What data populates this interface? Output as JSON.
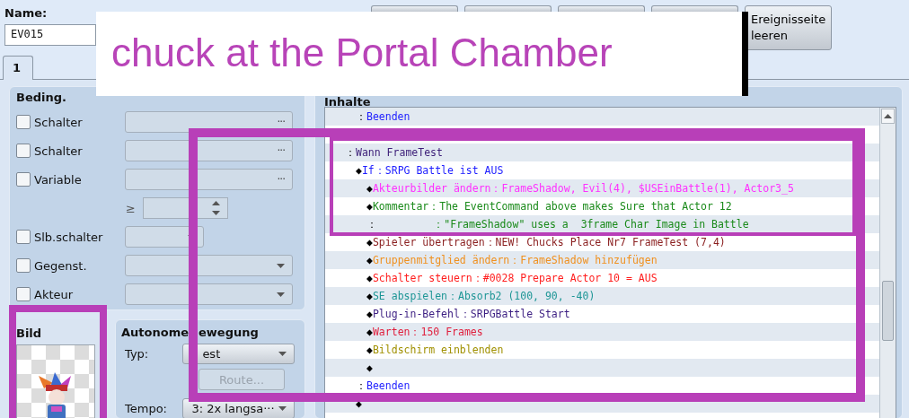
{
  "name_field": {
    "label": "Name:",
    "value": "EV015"
  },
  "page_buttons": [
    {
      "kind": "covered"
    },
    {
      "kind": "covered"
    },
    {
      "kind": "covered"
    },
    {
      "kind": "covered"
    },
    {
      "kind": "label",
      "label": "Ereignisseite leeren"
    }
  ],
  "tabs": [
    {
      "label": "1",
      "selected": true
    }
  ],
  "conditions": {
    "title": "Beding.",
    "rows": [
      {
        "kind": "picker",
        "label": "Schalter",
        "checked": false,
        "button": "···"
      },
      {
        "kind": "picker",
        "label": "Schalter",
        "checked": false,
        "button": "···"
      },
      {
        "kind": "picker",
        "label": "Variable",
        "checked": false,
        "button": "···"
      },
      {
        "kind": "spinner",
        "label": "≥"
      },
      {
        "kind": "small_dropdown",
        "label": "Slb.schalter",
        "checked": false
      },
      {
        "kind": "dropdown",
        "label": "Gegenst.",
        "checked": false
      },
      {
        "kind": "dropdown",
        "label": "Akteur",
        "checked": false
      }
    ]
  },
  "image": {
    "title": "Bild",
    "kind": "picture"
  },
  "autonomous_movement": {
    "title": "Autonome",
    "title_continued": "ewegung",
    "type": {
      "label": "Typ:",
      "value": "est"
    },
    "route_button": {
      "label": "Route...",
      "disabled": true
    },
    "speed": {
      "label": "Tempo:",
      "value": "3: 2x langsa···"
    }
  },
  "contents": {
    "title": "Inhalte",
    "items": [
      {
        "children": [
          {
            "marker": "：",
            "text": "Beenden",
            "color": "#1e1eff"
          },
          {
            "kind": "blank_row"
          }
        ]
      },
      {
        "marker": "：",
        "text": "Wann FrameTest",
        "color": "#3c1e78",
        "children": [
          {
            "marker": "◆",
            "text": "If：SRPG Battle ist AUS",
            "color": "#1e1eff",
            "children": [
              {
                "marker": "◆",
                "text": "Akteurbilder ändern：FrameShadow, Evil(4), $USEinBattle(1), Actor3_5",
                "color": "#ff30ff"
              },
              {
                "marker": "◆",
                "text": "Kommentar：The EventCommand above makes Sure that Actor 12",
                "color": "#1a8a1a"
              },
              {
                "marker": "：",
                "text": "         ：\"FrameShadow\" uses a  3frame Char Image in Battle",
                "color": "#1a8a1a"
              },
              {
                "marker": "◆",
                "text": "Spieler übertragen：NEW! Chucks Place Nr7 FrameTest (7,4)",
                "color": "#8a1e1e"
              },
              {
                "marker": "◆",
                "text": "Gruppenmitglied ändern：FrameShadow hinzufügen",
                "color": "#f0901e"
              },
              {
                "marker": "◆",
                "text": "Schalter steuern：#0028 Prepare Actor 10 = AUS",
                "color": "#ff1e1e"
              },
              {
                "marker": "◆",
                "text": "SE abspielen：Absorb2 (100, 90, -40)",
                "color": "#1e9696"
              },
              {
                "marker": "◆",
                "text": "Plug-in-Befehl：SRPGBattle Start",
                "color": "#3c1e82"
              },
              {
                "marker": "◆",
                "text": "Warten：150 Frames",
                "color": "#e01e3c"
              },
              {
                "marker": "◆",
                "text": "Bildschirm einblenden",
                "color": "#a09000"
              },
              {
                "marker": "◆"
              }
            ]
          },
          {
            "marker": "：",
            "text": "Beenden",
            "color": "#1e1eff"
          },
          {
            "marker": "◆"
          }
        ]
      }
    ]
  },
  "annotation": {
    "title": "chuck at the Portal Chamber"
  }
}
